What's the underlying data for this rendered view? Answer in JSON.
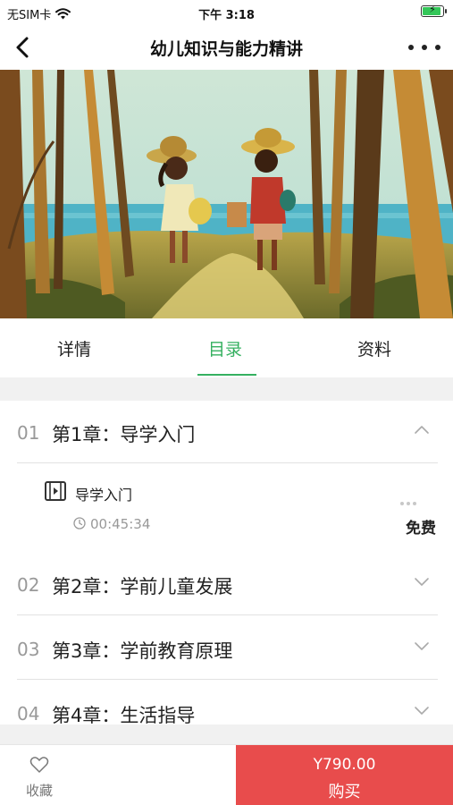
{
  "status_bar": {
    "carrier": "无SIM卡",
    "time": "下午 3:18",
    "battery_level": 0.9
  },
  "nav": {
    "title": "幼儿知识与能力精讲",
    "back_icon": "chevron-left-icon",
    "more_icon": "more-dots-icon"
  },
  "banner": {
    "image": "illustration-kids-on-beach-path"
  },
  "tabs": [
    {
      "label": "详情",
      "active": false
    },
    {
      "label": "目录",
      "active": true
    },
    {
      "label": "资料",
      "active": false
    }
  ],
  "accent_color": "#35b060",
  "chapters": [
    {
      "num": "01",
      "title": "第1章：导学入门",
      "expanded": true
    },
    {
      "num": "02",
      "title": "第2章：学前儿童发展",
      "expanded": false
    },
    {
      "num": "03",
      "title": "第3章：学前教育原理",
      "expanded": false
    },
    {
      "num": "04",
      "title": "第4章：生活指导",
      "expanded": false
    }
  ],
  "lesson": {
    "title": "导学入门",
    "duration": "00:45:34",
    "price_tag": "免费",
    "icon": "video-icon"
  },
  "bottom_bar": {
    "favorite_label": "收藏",
    "price": "Y790.00",
    "buy_label": "购买",
    "buy_color": "#e84c4c"
  }
}
